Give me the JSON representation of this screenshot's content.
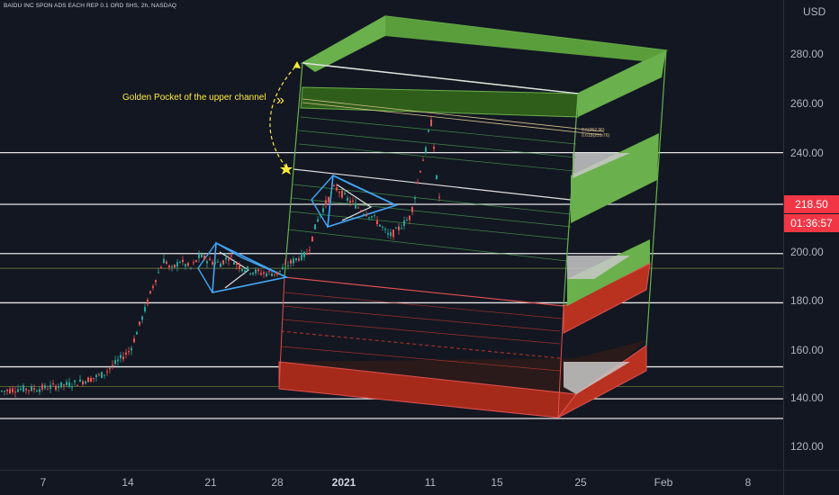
{
  "header": {
    "symbol_line": "BAIDU INC SPON ADS EACH REP 0.1 ORD SHS, 2h, NASDAQ"
  },
  "price_axis": {
    "currency": "USD",
    "ticks": [
      "280.00",
      "260.00",
      "240.00",
      "220.00",
      "200.00",
      "180.00",
      "160.00",
      "140.00",
      "120.00"
    ]
  },
  "time_axis": {
    "ticks": [
      "7",
      "14",
      "21",
      "28",
      "2021",
      "11",
      "15",
      "25",
      "Feb",
      "8"
    ]
  },
  "badges": {
    "last_price": "218.50",
    "countdown": "01:36:57"
  },
  "annotation": {
    "text": "Golden Pocket of the upper channel",
    "arrow_glyph": "»"
  },
  "fib_labels": {
    "a": "0.6(252.96)",
    "b": "0.618(251.76)"
  },
  "colors": {
    "background": "#131722",
    "up": "#26a69a",
    "down": "#ef5350",
    "channel_green": "#6ab04c",
    "channel_red": "#a62a1a",
    "pattern_blue": "#42a5f5",
    "annotation": "#ffeb3b",
    "badge": "#f23645"
  },
  "chart_data": {
    "type": "candlestick",
    "interval": "2h",
    "exchange": "NASDAQ",
    "y_range": [
      115,
      302
    ],
    "last_price": 218.5,
    "horizontal_levels": [
      240,
      219,
      199,
      193,
      179,
      153,
      145,
      140,
      132
    ],
    "channel_top_y": 272,
    "channel_bottom_y": 137,
    "fib_levels": [
      252.96,
      251.76
    ],
    "price_path": [
      [
        0,
        143
      ],
      [
        20,
        144
      ],
      [
        40,
        144
      ],
      [
        60,
        145
      ],
      [
        80,
        146
      ],
      [
        100,
        148
      ],
      [
        115,
        150
      ],
      [
        130,
        155
      ],
      [
        145,
        160
      ],
      [
        160,
        175
      ],
      [
        172,
        188
      ],
      [
        183,
        197
      ],
      [
        190,
        192
      ],
      [
        200,
        196
      ],
      [
        212,
        193
      ],
      [
        222,
        198
      ],
      [
        232,
        196
      ],
      [
        245,
        195
      ],
      [
        255,
        198
      ],
      [
        265,
        194
      ],
      [
        278,
        192
      ],
      [
        292,
        191
      ],
      [
        308,
        191
      ],
      [
        318,
        194
      ],
      [
        330,
        197
      ],
      [
        342,
        199
      ],
      [
        352,
        212
      ],
      [
        360,
        218
      ],
      [
        366,
        222
      ],
      [
        372,
        226
      ],
      [
        378,
        224
      ],
      [
        386,
        221
      ],
      [
        394,
        219
      ],
      [
        404,
        216
      ],
      [
        414,
        214
      ],
      [
        424,
        210
      ],
      [
        432,
        206
      ],
      [
        440,
        208
      ],
      [
        448,
        211
      ],
      [
        456,
        214
      ],
      [
        462,
        224
      ],
      [
        468,
        235
      ],
      [
        474,
        242
      ],
      [
        478,
        254
      ],
      [
        481,
        248
      ],
      [
        484,
        232
      ],
      [
        488,
        222
      ],
      [
        491,
        219
      ]
    ]
  }
}
